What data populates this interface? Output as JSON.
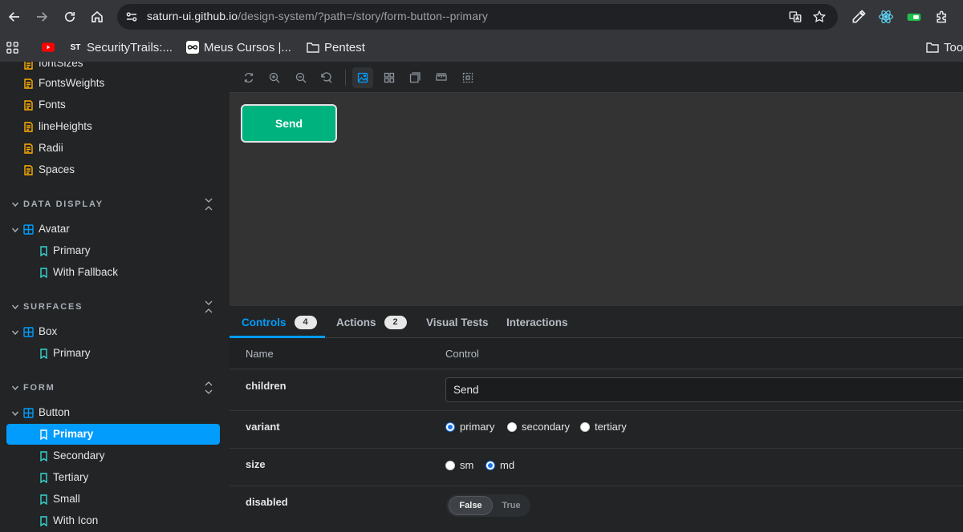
{
  "browser": {
    "url_host": "saturn-ui.github.io",
    "url_path": "/design-system/?path=/story/form-button--primary",
    "bookmarks": [
      {
        "label": ""
      },
      {
        "label": "SecurityTrails:..."
      },
      {
        "label": "Meus Cursos |..."
      },
      {
        "label": "Pentest"
      },
      {
        "label": "Too"
      }
    ]
  },
  "sidebar": {
    "partial_top": "fontSizes",
    "tokens": [
      "FontsWeights",
      "Fonts",
      "lineHeights",
      "Radii",
      "Spaces"
    ],
    "sections": [
      {
        "title": "DATA DISPLAY",
        "component": "Avatar",
        "stories": [
          "Primary",
          "With Fallback"
        ]
      },
      {
        "title": "SURFACES",
        "component": "Box",
        "stories": [
          "Primary"
        ]
      },
      {
        "title": "FORM",
        "component": "Button",
        "stories": [
          "Primary",
          "Secondary",
          "Tertiary",
          "Small",
          "With Icon"
        ]
      }
    ]
  },
  "preview": {
    "button_label": "Send"
  },
  "addons": {
    "tabs": [
      {
        "label": "Controls",
        "badge": "4"
      },
      {
        "label": "Actions",
        "badge": "2"
      },
      {
        "label": "Visual Tests"
      },
      {
        "label": "Interactions"
      }
    ],
    "table": {
      "headers": {
        "name": "Name",
        "control": "Control"
      },
      "rows": {
        "children": {
          "name": "children",
          "value": "Send"
        },
        "variant": {
          "name": "variant",
          "options": [
            "primary",
            "secondary",
            "tertiary"
          ],
          "selected": "primary"
        },
        "size": {
          "name": "size",
          "options": [
            "sm",
            "md"
          ],
          "selected": "md"
        },
        "disabled": {
          "name": "disabled",
          "false_label": "False",
          "true_label": "True",
          "selected": "False"
        }
      }
    }
  },
  "colors": {
    "accent": "#029cfd",
    "button_green": "#00b37e"
  }
}
